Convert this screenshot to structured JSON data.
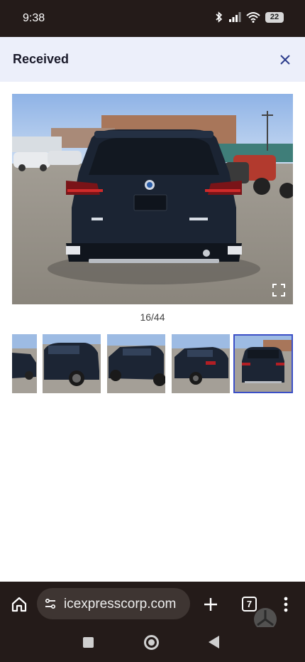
{
  "status_bar": {
    "time": "9:38",
    "battery": "22",
    "icons": [
      "bluetooth-icon",
      "signal-icon",
      "wifi-icon",
      "battery-icon"
    ]
  },
  "header": {
    "title": "Received",
    "close_icon": "close-icon"
  },
  "gallery": {
    "counter": "16/44",
    "current_index": 16,
    "total": 44,
    "thumbnails_visible": 5,
    "selected_thumbnail": 5
  },
  "browser": {
    "url": "icexpresscorp.com",
    "tab_count": "7",
    "icons": [
      "home-icon",
      "site-settings-icon",
      "plus-icon",
      "tabs-icon",
      "more-vert-icon"
    ]
  },
  "system_nav": {
    "icons": [
      "recents-icon",
      "home-icon",
      "back-icon"
    ]
  },
  "colors": {
    "system_bar": "#241b19",
    "header_bg": "#eceffa",
    "accent": "#3b4fc6",
    "url_pill": "#3e3532"
  }
}
